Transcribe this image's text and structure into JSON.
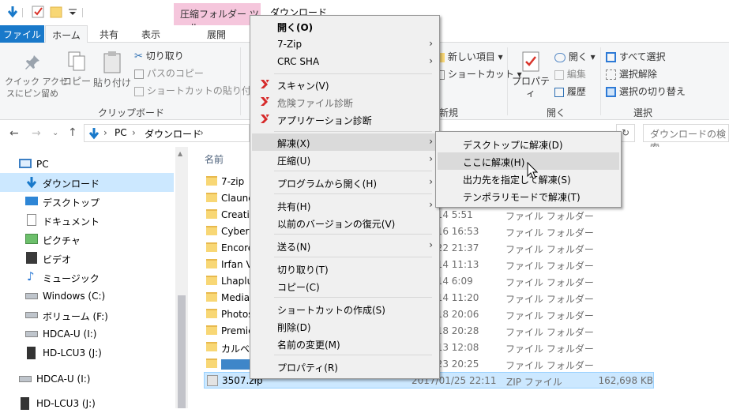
{
  "titlebar": {
    "context_tab": "圧縮フォルダー ツール",
    "title": "ダウンロード"
  },
  "ribbon_tabs": {
    "file": "ファイル",
    "home": "ホーム",
    "share": "共有",
    "view": "表示",
    "manage": "展開"
  },
  "ribbon": {
    "pin": "クイック アクセ\nスにピン留め",
    "copy": "コピー",
    "paste": "貼り付け",
    "cut": "切り取り",
    "copy_path": "パスのコピー",
    "paste_shortcut": "ショートカットの貼り付け",
    "clipboard_group": "クリップボード",
    "new_item": "新しい項目",
    "shortcut": "ショートカット",
    "new_group": "新規",
    "properties": "プロパティ",
    "open": "開く",
    "edit": "編集",
    "history": "履歴",
    "open_group": "開く",
    "select_all": "すべて選択",
    "select_none": "選択解除",
    "invert_selection": "選択の切り替え",
    "select_group": "選択"
  },
  "address": {
    "pc": "PC",
    "folder": "ダウンロード",
    "search_placeholder": "ダウンロードの検索"
  },
  "nav": {
    "items": [
      "PC",
      "ダウンロード",
      "デスクトップ",
      "ドキュメント",
      "ピクチャ",
      "ビデオ",
      "ミュージック",
      "Windows (C:)",
      "ボリューム (F:)",
      "HDCA-U (I:)",
      "HD-LCU3 (J:)",
      "HDCA-U (I:)",
      "HD-LCU3 (J:)"
    ]
  },
  "columns": {
    "name": "名前"
  },
  "files": [
    {
      "name": "7-zip",
      "date": "",
      "type": "",
      "size": ""
    },
    {
      "name": "Claunc",
      "date": "",
      "type": "",
      "size": ""
    },
    {
      "name": "Creativ",
      "date": "",
      "type": "",
      "size": ""
    },
    {
      "name": "CyberL",
      "date": "",
      "type": "",
      "size": ""
    },
    {
      "name": "Encore",
      "date": "",
      "type": "",
      "size": ""
    },
    {
      "name": "Irfan Vi",
      "date": "",
      "type": "",
      "size": ""
    },
    {
      "name": "Lhaplu",
      "date": "",
      "type": "",
      "size": ""
    },
    {
      "name": "Media",
      "date": "",
      "type": "",
      "size": ""
    },
    {
      "name": "Photos",
      "date": "",
      "type": "",
      "size": ""
    },
    {
      "name": "Premie",
      "date": "",
      "type": "",
      "size": ""
    },
    {
      "name": "カルベル",
      "date": "",
      "type": "",
      "size": ""
    },
    {
      "name": "",
      "date": "",
      "type": "",
      "size": ""
    },
    {
      "name": "3507.zip",
      "date": "2017/01/25 22:11",
      "type": "ZIP ファイル",
      "size": "162,698 KB"
    }
  ],
  "file_fragments": {
    "dates": [
      "9/14 5:51",
      "9/16 16:53",
      "1/22 21:37",
      "9/14 11:13",
      "9/14 6:09",
      "9/14 11:20",
      "0/18 20:06",
      "0/18 20:28",
      "9/13 12:08",
      "1/23 20:25"
    ],
    "type": "ファイル フォルダー"
  },
  "context_menu": {
    "open": "開く(O)",
    "sevenzip": "7-Zip",
    "crc": "CRC SHA",
    "scan": "スキャン(V)",
    "danger_diag": "危険ファイル診断",
    "app_diag": "アプリケーション診断",
    "extract": "解凍(X)",
    "compress": "圧縮(U)",
    "open_with": "プログラムから開く(H)",
    "share": "共有(H)",
    "restore": "以前のバージョンの復元(V)",
    "send_to": "送る(N)",
    "cut": "切り取り(T)",
    "copy": "コピー(C)",
    "create_shortcut": "ショートカットの作成(S)",
    "delete": "削除(D)",
    "rename": "名前の変更(M)",
    "properties": "プロパティ(R)"
  },
  "submenu": {
    "to_desktop": "デスクトップに解凍(D)",
    "here": "ここに解凍(H)",
    "to_dest": "出力先を指定して解凍(S)",
    "temp": "テンポラリモードで解凍(T)"
  },
  "colors": {
    "accent": "#1979ca",
    "context_tab": "#f5c6dc",
    "selection": "#cce8ff"
  }
}
